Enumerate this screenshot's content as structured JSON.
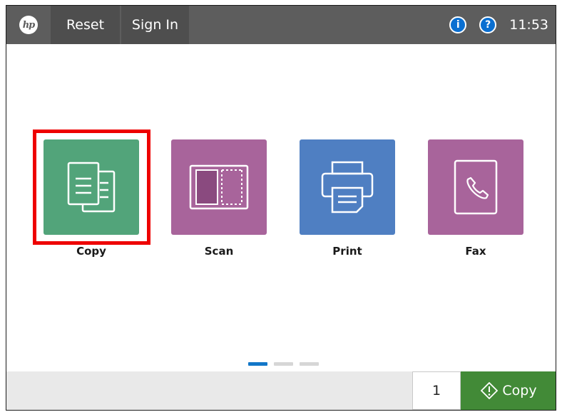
{
  "topbar": {
    "logo_text": "hp",
    "reset_label": "Reset",
    "signin_label": "Sign In",
    "info_icon": "i",
    "help_icon": "?",
    "time": "11:53"
  },
  "apps": [
    {
      "id": "copy",
      "label": "Copy",
      "color": "#52a47a",
      "icon": "copy-icon",
      "selected": true
    },
    {
      "id": "scan",
      "label": "Scan",
      "color": "#a8649b",
      "icon": "scan-icon",
      "selected": false
    },
    {
      "id": "print",
      "label": "Print",
      "color": "#4f7fc2",
      "icon": "print-icon",
      "selected": false
    },
    {
      "id": "fax",
      "label": "Fax",
      "color": "#a8649b",
      "icon": "fax-icon",
      "selected": false
    }
  ],
  "pager": {
    "pages": 3,
    "current": 1
  },
  "bottombar": {
    "copies": "1",
    "copy_button_label": "Copy",
    "copy_button_color": "#428a37"
  }
}
